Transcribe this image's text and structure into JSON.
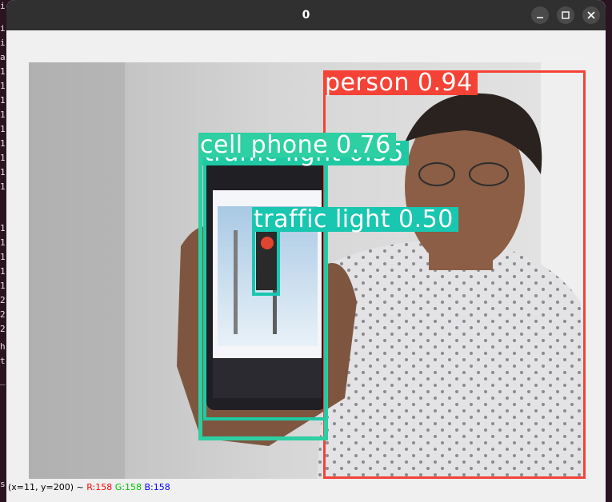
{
  "window": {
    "title": "0",
    "controls": {
      "minimize_icon": "minimize-icon",
      "maximize_icon": "maximize-icon",
      "close_icon": "close-icon"
    }
  },
  "background_terminal": {
    "visible_chars": [
      "i",
      "i",
      "i",
      "a",
      "1",
      "1",
      "1",
      "1",
      "1",
      "1",
      "1",
      "1",
      "1",
      "1",
      "1",
      "1",
      "1",
      "1",
      "2",
      "2",
      "2",
      "h",
      "t",
      "_",
      "s"
    ]
  },
  "detections": [
    {
      "label": "person 0.94",
      "color": "#f44336"
    },
    {
      "label": "cell phone 0.76",
      "color": "#2ecfa2"
    },
    {
      "label": "traffic light 0.55",
      "color": "#1fc9a3"
    },
    {
      "label": "traffic light 0.50",
      "color": "#19c6b0"
    }
  ],
  "status": {
    "coords": "(x=11, y=200) ~",
    "r": "R:158",
    "g": "G:158",
    "b": "B:158",
    "r_color": "#ff0000",
    "g_color": "#00c000",
    "b_color": "#0000ff"
  }
}
